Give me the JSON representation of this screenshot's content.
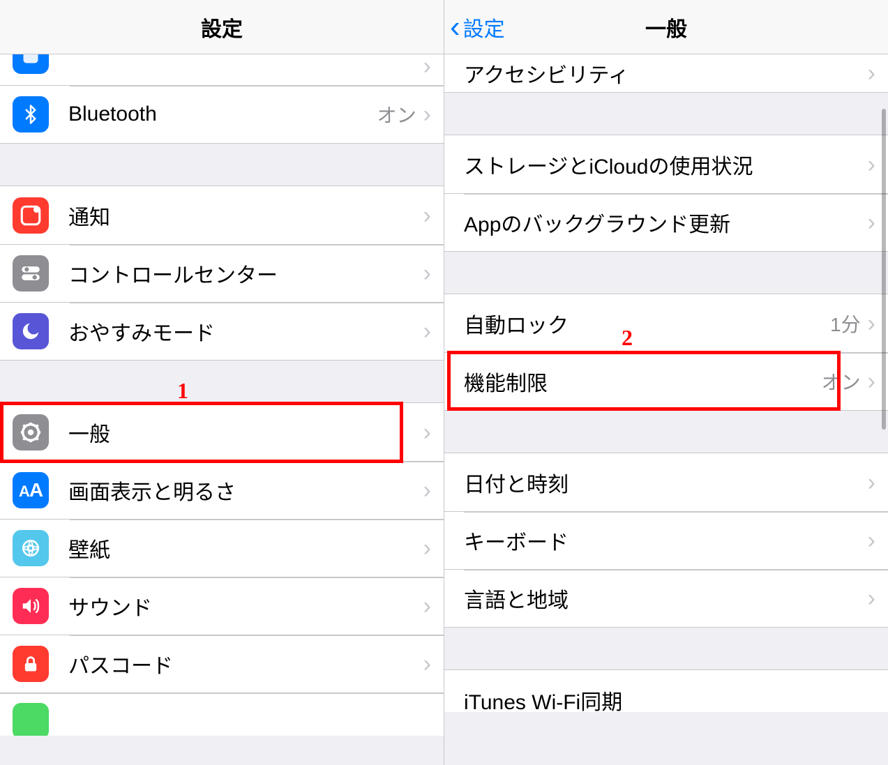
{
  "left": {
    "header_title": "設定",
    "rows": {
      "partial_app": "",
      "bluetooth": {
        "label": "Bluetooth",
        "value": "オン"
      },
      "notifications": {
        "label": "通知"
      },
      "control_center": {
        "label": "コントロールセンター"
      },
      "dnd": {
        "label": "おやすみモード"
      },
      "general": {
        "label": "一般"
      },
      "display": {
        "label": "画面表示と明るさ"
      },
      "wallpaper": {
        "label": "壁紙"
      },
      "sounds": {
        "label": "サウンド"
      },
      "passcode": {
        "label": "パスコード"
      }
    }
  },
  "right": {
    "back_label": "設定",
    "header_title": "一般",
    "rows": {
      "accessibility": {
        "label": "アクセシビリティ"
      },
      "storage": {
        "label": "ストレージとiCloudの使用状況"
      },
      "bg_refresh": {
        "label": "Appのバックグラウンド更新"
      },
      "auto_lock": {
        "label": "自動ロック",
        "value": "1分"
      },
      "restrictions": {
        "label": "機能制限",
        "value": "オン"
      },
      "date_time": {
        "label": "日付と時刻"
      },
      "keyboard": {
        "label": "キーボード"
      },
      "language": {
        "label": "言語と地域"
      },
      "itunes_wifi": {
        "label": "iTunes Wi-Fi同期"
      }
    }
  },
  "annotations": {
    "one": "1",
    "two": "2"
  }
}
